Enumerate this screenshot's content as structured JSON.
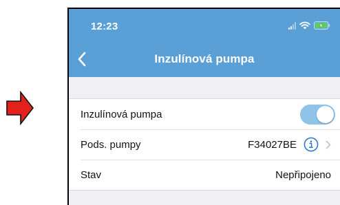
{
  "status_bar": {
    "time": "12:23"
  },
  "nav_bar": {
    "title": "Inzulínová pumpa"
  },
  "settings": {
    "rows": [
      {
        "label": "Inzulínová pumpa",
        "toggle_on": true
      },
      {
        "label": "Pods. pumpy",
        "value": "F34027BE"
      },
      {
        "label": "Stav",
        "value": "Nepřipojeno"
      }
    ]
  },
  "colors": {
    "nav_background": "#5aa0d6",
    "toggle_on": "#8ec4e8",
    "accent": "#2b7bd2",
    "pointer_arrow_fill": "#e3201b"
  },
  "icons": {
    "pointer": "right-arrow-icon",
    "back": "chevron-left-icon",
    "info": "info-circle-icon",
    "disclosure": "chevron-right-icon",
    "signal": "cellular-signal-icon",
    "wifi": "wifi-icon",
    "battery": "battery-charging-icon"
  }
}
